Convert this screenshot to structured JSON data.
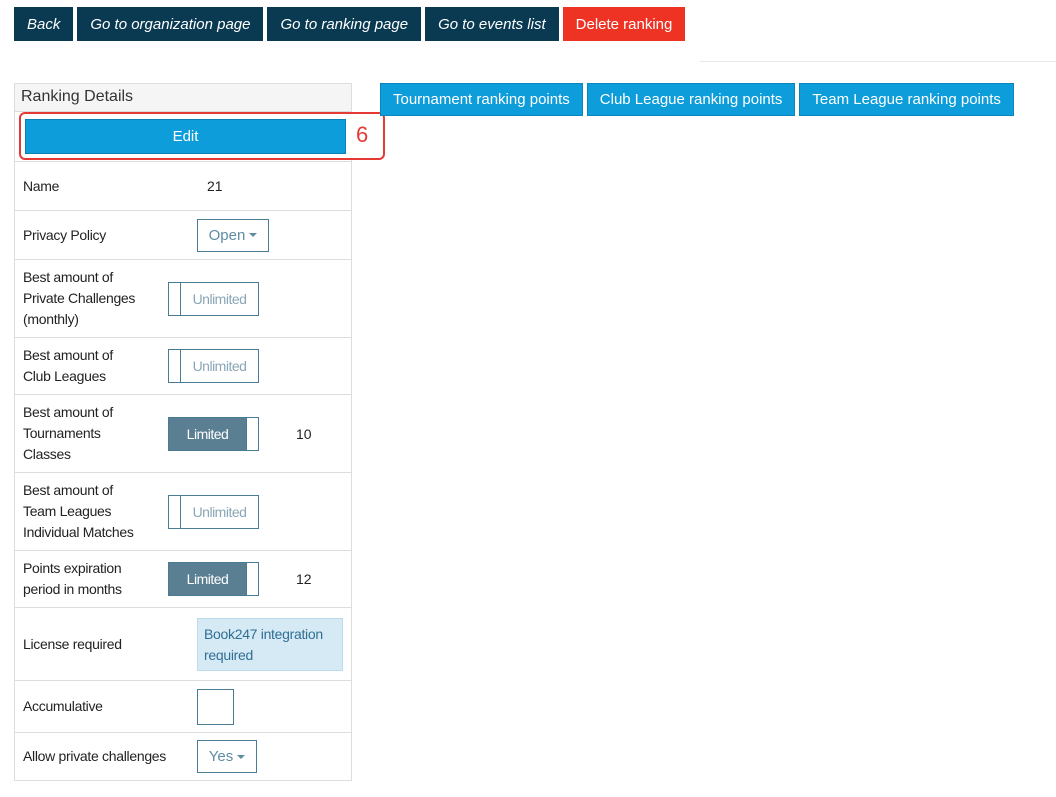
{
  "topnav": {
    "back": "Back",
    "organization": "Go to organization page",
    "ranking": "Go to ranking page",
    "events": "Go to events list",
    "delete": "Delete ranking"
  },
  "panel": {
    "title": "Ranking Details",
    "edit_label": "Edit",
    "edit_badge": "6"
  },
  "rows": {
    "name": {
      "label": "Name",
      "value": "21"
    },
    "privacy": {
      "label": "Privacy Policy",
      "value": "Open"
    },
    "private_challenges": {
      "label": "Best amount of Private Challenges (monthly)",
      "toggle": "Unlimited"
    },
    "club_leagues": {
      "label": "Best amount of Club Leagues",
      "toggle": "Unlimited"
    },
    "tournaments": {
      "label": "Best amount of Tournaments Classes",
      "toggle": "Limited",
      "value": "10"
    },
    "team_leagues": {
      "label": "Best amount of Team Leagues Individual Matches",
      "toggle": "Unlimited"
    },
    "expiration": {
      "label": "Points expiration period in months",
      "toggle": "Limited",
      "value": "12"
    },
    "license": {
      "label": "License required",
      "info": "Book247 integration required"
    },
    "accumulative": {
      "label": "Accumulative"
    },
    "allow_private": {
      "label": "Allow private challenges",
      "value": "Yes"
    }
  },
  "point_tabs": {
    "tournament": "Tournament ranking points",
    "club": "Club League ranking points",
    "team": "Team League ranking points"
  },
  "colors": {
    "nav_dark": "#0a3a52",
    "danger": "#ee3224",
    "primary": "#0d9ddb",
    "toggle_on": "#5a7f92",
    "highlight": "#e53935"
  }
}
